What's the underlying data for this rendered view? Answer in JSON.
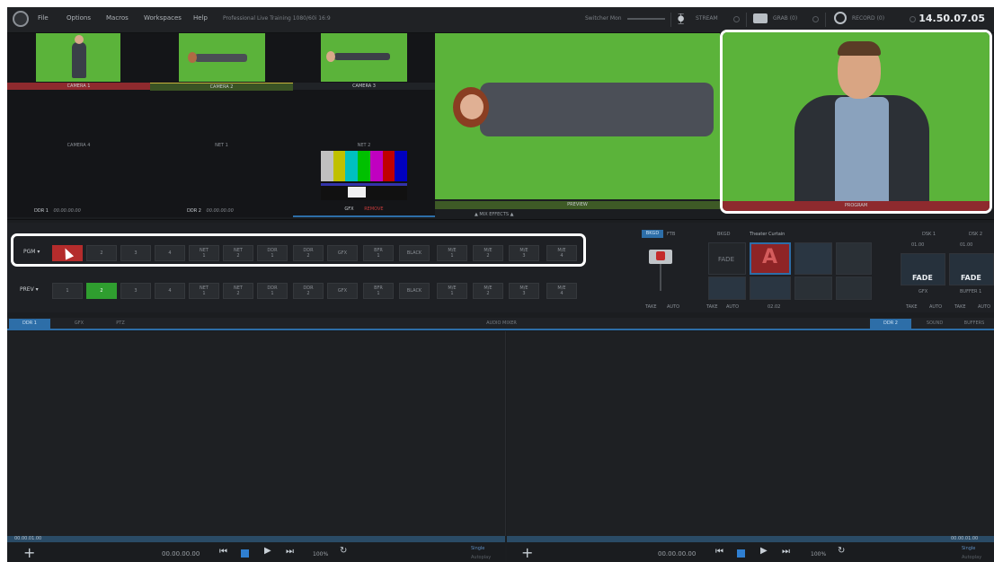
{
  "menubar": {
    "items": [
      "File",
      "Options",
      "Macros",
      "Workspaces",
      "Help"
    ],
    "session": "Professional Live Training  1080/60i 16:9",
    "switcher_mon": "Switcher Mon",
    "stream": "STREAM",
    "grab": "GRAB (0)",
    "record": "RECORD (0)",
    "clock": "14.50.07.05"
  },
  "monitors": {
    "cam1": "CAMERA 1",
    "cam2": "CAMERA 2",
    "cam3": "CAMERA 3",
    "cam4": "CAMERA 4",
    "net1": "NET 1",
    "net2": "NET 2",
    "ddr1": "DDR 1",
    "ddr1_time": "00.00.00.00",
    "ddr2": "DDR 2",
    "ddr2_time": "00.00.00.00",
    "gfx": "GFX",
    "gfx_tag": "REMOVE",
    "preview": "PREVIEW",
    "program": "PROGRAM",
    "mix_effects": "▲ MIX EFFECTS ▲"
  },
  "switcher": {
    "pgm_label": "PGM ▾",
    "prev_label": "PREV ▾",
    "buttons": [
      "1",
      "2",
      "3",
      "4",
      "NET\n1",
      "NET\n2",
      "DDR\n1",
      "DDR\n2",
      "GFX",
      "BFR\n1",
      "BLACK",
      "M/E\n1",
      "M/E\n2",
      "M/E\n3",
      "M/E\n4"
    ]
  },
  "transition": {
    "bkgd": "BKGD",
    "ftb": "FTB",
    "bkgd2": "BKGD",
    "curtain": "Theater Curtain",
    "fade": "FADE",
    "take": "TAKE",
    "auto": "AUTO",
    "duration": "02.02",
    "dsk1": "DSK 1",
    "dsk2": "DSK 2",
    "dsk1_time": "01.00",
    "dsk2_time": "01.00",
    "dsk1_fade": "FADE",
    "dsk2_fade": "FADE",
    "dsk1_src": "GFX",
    "dsk2_src": "BUFFER 1"
  },
  "tabs_left": [
    "DDR 1",
    "GFX",
    "PTZ"
  ],
  "audio_mixer": "AUDIO MIXER",
  "tabs_right": [
    "DDR 2",
    "SOUND",
    "BUFFERS"
  ],
  "ddr_left": {
    "timecode": "00.00.01.00",
    "position": "00.00.00.00",
    "speed": "100%",
    "mode": "Single",
    "mode2": "Autoplay"
  },
  "ddr_right": {
    "timecode": "00.00.01.00",
    "position": "00.00.00.00",
    "speed": "100%",
    "mode": "Single",
    "mode2": "Autoplay"
  },
  "colors": {
    "program_red": "#b42c2c",
    "preview_green": "#2f9e2f",
    "accent_blue": "#2d6ea8",
    "green_screen": "#5bb33a"
  }
}
